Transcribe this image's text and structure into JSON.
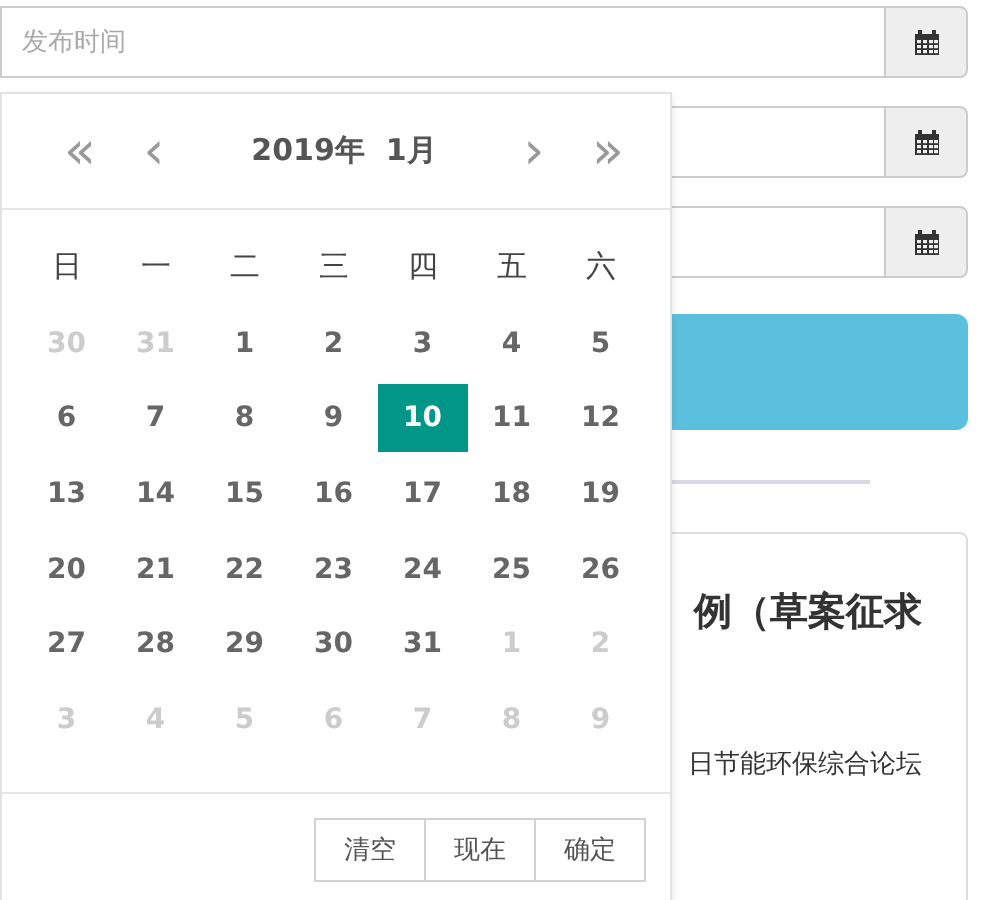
{
  "fields": [
    {
      "kind": "date",
      "placeholder": "发布时间"
    },
    {
      "kind": "date"
    },
    {
      "kind": "date"
    }
  ],
  "article": {
    "title": "例（草案征求",
    "text": "日节能环保综合论坛"
  },
  "calendar": {
    "year": "2019年",
    "month": "1月",
    "prev_year": "«",
    "prev_month": "‹",
    "next_month": "›",
    "next_year": "»",
    "weekdays": [
      "日",
      "一",
      "二",
      "三",
      "四",
      "五",
      "六"
    ],
    "weeks": [
      [
        {
          "label": "30",
          "outside": true,
          "selected": false
        },
        {
          "label": "31",
          "outside": true,
          "selected": false
        },
        {
          "label": "1",
          "outside": false,
          "selected": false
        },
        {
          "label": "2",
          "outside": false,
          "selected": false
        },
        {
          "label": "3",
          "outside": false,
          "selected": false
        },
        {
          "label": "4",
          "outside": false,
          "selected": false
        },
        {
          "label": "5",
          "outside": false,
          "selected": false
        }
      ],
      [
        {
          "label": "6",
          "outside": false,
          "selected": false
        },
        {
          "label": "7",
          "outside": false,
          "selected": false
        },
        {
          "label": "8",
          "outside": false,
          "selected": false
        },
        {
          "label": "9",
          "outside": false,
          "selected": false
        },
        {
          "label": "10",
          "outside": false,
          "selected": true
        },
        {
          "label": "11",
          "outside": false,
          "selected": false
        },
        {
          "label": "12",
          "outside": false,
          "selected": false
        }
      ],
      [
        {
          "label": "13",
          "outside": false,
          "selected": false
        },
        {
          "label": "14",
          "outside": false,
          "selected": false
        },
        {
          "label": "15",
          "outside": false,
          "selected": false
        },
        {
          "label": "16",
          "outside": false,
          "selected": false
        },
        {
          "label": "17",
          "outside": false,
          "selected": false
        },
        {
          "label": "18",
          "outside": false,
          "selected": false
        },
        {
          "label": "19",
          "outside": false,
          "selected": false
        }
      ],
      [
        {
          "label": "20",
          "outside": false,
          "selected": false
        },
        {
          "label": "21",
          "outside": false,
          "selected": false
        },
        {
          "label": "22",
          "outside": false,
          "selected": false
        },
        {
          "label": "23",
          "outside": false,
          "selected": false
        },
        {
          "label": "24",
          "outside": false,
          "selected": false
        },
        {
          "label": "25",
          "outside": false,
          "selected": false
        },
        {
          "label": "26",
          "outside": false,
          "selected": false
        }
      ],
      [
        {
          "label": "27",
          "outside": false,
          "selected": false
        },
        {
          "label": "28",
          "outside": false,
          "selected": false
        },
        {
          "label": "29",
          "outside": false,
          "selected": false
        },
        {
          "label": "30",
          "outside": false,
          "selected": false
        },
        {
          "label": "31",
          "outside": false,
          "selected": false
        },
        {
          "label": "1",
          "outside": true,
          "selected": false
        },
        {
          "label": "2",
          "outside": true,
          "selected": false
        }
      ],
      [
        {
          "label": "3",
          "outside": true,
          "selected": false
        },
        {
          "label": "4",
          "outside": true,
          "selected": false
        },
        {
          "label": "5",
          "outside": true,
          "selected": false
        },
        {
          "label": "6",
          "outside": true,
          "selected": false
        },
        {
          "label": "7",
          "outside": true,
          "selected": false
        },
        {
          "label": "8",
          "outside": true,
          "selected": false
        },
        {
          "label": "9",
          "outside": true,
          "selected": false
        }
      ]
    ],
    "buttons": [
      "清空",
      "现在",
      "确定"
    ]
  }
}
